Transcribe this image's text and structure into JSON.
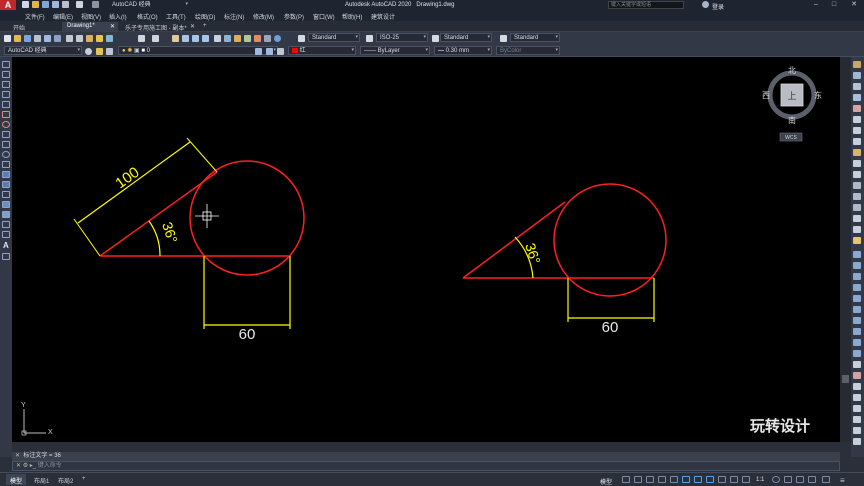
{
  "app": {
    "window_title": "Autodesk AutoCAD 2020",
    "file_name": "Drawing1.dwg",
    "workspace": "AutoCAD 经典",
    "logo_letter": "A",
    "search_placeholder": "键入关键字或短语",
    "login": "登录"
  },
  "menu": {
    "items": [
      "文件(F)",
      "编辑(E)",
      "视图(V)",
      "插入(I)",
      "格式(O)",
      "工具(T)",
      "绘图(D)",
      "标注(N)",
      "修改(M)",
      "参数(P)",
      "窗口(W)",
      "帮助(H)",
      "建筑设计"
    ]
  },
  "tabs": [
    {
      "label": "开始"
    },
    {
      "label": "Drawing1*"
    },
    {
      "label": "乐子专用施工图 - 副本*"
    }
  ],
  "toolbar": {
    "workspace_combo": "AutoCAD 经典",
    "text_style": "Standard",
    "dim_style": "ISO-25",
    "table_style": "Standard",
    "mleader_style": "Standard",
    "layer": "0",
    "color": "红",
    "color_swatch": "#ff0000",
    "linetype": "ByLayer",
    "lineweight": "0.30 mm",
    "plotstyle": "ByColor"
  },
  "viewcube": {
    "north": "北",
    "south": "南",
    "east": "东",
    "west": "西",
    "top": "上",
    "wcs": "WCS"
  },
  "ucs": {
    "x_label": "X",
    "y_label": "Y"
  },
  "drawing": {
    "left_dim_length": "100",
    "left_dim_angle": "36°",
    "left_dim_width": "60",
    "right_dim_angle": "36°",
    "right_dim_width": "60",
    "line_color": "#ff2020",
    "dim_color": "#ffff00"
  },
  "watermark": "玩转设计",
  "command": {
    "history": "标注文字 = 36",
    "prompt": "键入命令"
  },
  "status": {
    "model_tab": "模型",
    "layout1": "布局1",
    "layout2": "布局2",
    "mode_label": "模型",
    "scale": "1:1"
  }
}
